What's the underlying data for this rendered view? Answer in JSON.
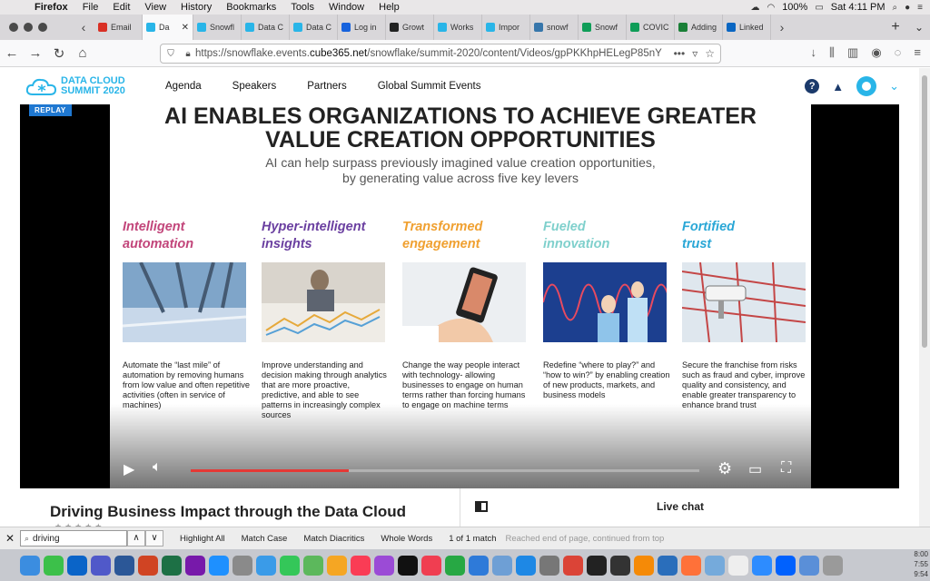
{
  "menubar": {
    "app": "Firefox",
    "items": [
      "File",
      "Edit",
      "View",
      "History",
      "Bookmarks",
      "Tools",
      "Window",
      "Help"
    ],
    "battery": "100%",
    "clock": "Sat 4:11 PM"
  },
  "tabs": [
    {
      "label": "Email",
      "icon": "gmail-icon",
      "color": "#d93025"
    },
    {
      "label": "Da",
      "icon": "snowflake-icon",
      "color": "#29b5e8",
      "active": true
    },
    {
      "label": "Snowfl",
      "icon": "snowflake-icon",
      "color": "#29b5e8"
    },
    {
      "label": "Data C",
      "icon": "snowflake-icon",
      "color": "#29b5e8"
    },
    {
      "label": "Data C",
      "icon": "snowflake-icon",
      "color": "#29b5e8"
    },
    {
      "label": "Log in",
      "icon": "okta-icon",
      "color": "#1662dd"
    },
    {
      "label": "Growt",
      "icon": "chart-icon",
      "color": "#222"
    },
    {
      "label": "Works",
      "icon": "snowflake-icon",
      "color": "#29b5e8"
    },
    {
      "label": "Impor",
      "icon": "snowflake-icon",
      "color": "#29b5e8"
    },
    {
      "label": "snowf",
      "icon": "python-icon",
      "color": "#3776ab"
    },
    {
      "label": "Snowf",
      "icon": "sheets-icon",
      "color": "#0f9d58"
    },
    {
      "label": "COVIC",
      "icon": "sheets-icon",
      "color": "#0f9d58"
    },
    {
      "label": "Adding",
      "icon": "gear-icon",
      "color": "#1a7f37"
    },
    {
      "label": "Linked",
      "icon": "linkedin-icon",
      "color": "#0a66c2"
    }
  ],
  "url": {
    "prefix": "https://snowflake.events.",
    "domain": "cube365.net",
    "path": "/snowflake/summit-2020/content/Videos/gpPKKhpHELegP85nY"
  },
  "site": {
    "logo_line1": "DATA CLOUD",
    "logo_line2": "SUMMIT 2020",
    "nav": [
      "Agenda",
      "Speakers",
      "Partners",
      "Global Summit Events"
    ]
  },
  "video": {
    "badge": "REPLAY",
    "title_line1": "AI ENABLES ORGANIZATIONS TO ACHIEVE GREATER",
    "title_line2": "VALUE CREATION OPPORTUNITIES",
    "subtitle_line1": "AI can help surpass previously imagined value creation opportunities,",
    "subtitle_line2": "by generating value across five key levers",
    "progress": 0.31,
    "levers": [
      {
        "line1": "Intelligent",
        "line2": "automation",
        "color": "#c2457a",
        "text": "Automate the “last mile” of automation by removing humans from low value and often repetitive activities (often in service of machines)"
      },
      {
        "line1": "Hyper-intelligent",
        "line2": "insights",
        "color": "#6a3fa0",
        "text": "Improve understanding and decision making through analytics that are more proactive, predictive, and able to see patterns in increasingly complex sources"
      },
      {
        "line1": "Transformed",
        "line2": "engagement",
        "color": "#f0a030",
        "text": "Change the way people interact with technology- allowing businesses to engage on human terms rather than forcing humans to engage on machine terms"
      },
      {
        "line1": "Fueled",
        "line2": "innovation",
        "color": "#7fd0cc",
        "text": "Redefine “where to play?” and “how to win?” by enabling creation of new products, markets, and business models"
      },
      {
        "line1": "Fortified",
        "line2": "trust",
        "color": "#2aa7d6",
        "text": "Secure the franchise from risks such as fraud and cyber, improve quality and consistency, and enable greater transparency to enhance brand trust"
      }
    ]
  },
  "page": {
    "title": "Driving Business Impact through the Data Cloud",
    "chat_label": "Live chat"
  },
  "findbar": {
    "query": "driving",
    "highlight_all": "Highlight All",
    "match_case": "Match Case",
    "match_diacritics": "Match Diacritics",
    "whole_words": "Whole Words",
    "status": "1 of 1 match",
    "note": "Reached end of page, continued from top"
  },
  "dock": {
    "icons": [
      {
        "name": "finder-icon",
        "color": "#3b8de0"
      },
      {
        "name": "facetime-icon",
        "color": "#3cc04a"
      },
      {
        "name": "outlook-icon",
        "color": "#0a64c8"
      },
      {
        "name": "teams-icon",
        "color": "#5059c9"
      },
      {
        "name": "word-icon",
        "color": "#2b5797"
      },
      {
        "name": "powerpoint-icon",
        "color": "#d04423"
      },
      {
        "name": "excel-icon",
        "color": "#1d7045"
      },
      {
        "name": "onenote-icon",
        "color": "#7719aa"
      },
      {
        "name": "safari-icon",
        "color": "#1e90ff"
      },
      {
        "name": "launchpad-icon",
        "color": "#8a8a8a"
      },
      {
        "name": "mail-icon",
        "color": "#3a9be8"
      },
      {
        "name": "messages-icon",
        "color": "#34c759"
      },
      {
        "name": "maps-icon",
        "color": "#5cb85c"
      },
      {
        "name": "photos-icon",
        "color": "#f5a623"
      },
      {
        "name": "music-icon",
        "color": "#fa3c55"
      },
      {
        "name": "podcasts-icon",
        "color": "#9b4bd6"
      },
      {
        "name": "tv-icon",
        "color": "#111111"
      },
      {
        "name": "news-icon",
        "color": "#f03e51"
      },
      {
        "name": "numbers-icon",
        "color": "#27a844"
      },
      {
        "name": "keynote-icon",
        "color": "#2e7ad9"
      },
      {
        "name": "preview-icon",
        "color": "#6e9fd5"
      },
      {
        "name": "appstore-icon",
        "color": "#1e88e5"
      },
      {
        "name": "settings-icon",
        "color": "#777777"
      },
      {
        "name": "chrome-icon",
        "color": "#db4437"
      },
      {
        "name": "terminal-icon",
        "color": "#222222"
      },
      {
        "name": "activity-monitor-icon",
        "color": "#333333"
      },
      {
        "name": "sublime-icon",
        "color": "#f58a07"
      },
      {
        "name": "sourcetree-icon",
        "color": "#2a6ebb"
      },
      {
        "name": "firefox-icon",
        "color": "#ff7139"
      },
      {
        "name": "rstudio-icon",
        "color": "#75aadb"
      },
      {
        "name": "textedit-icon",
        "color": "#eeeeee"
      },
      {
        "name": "zoom-icon",
        "color": "#2d8cff"
      },
      {
        "name": "dropbox-icon",
        "color": "#0061fe"
      },
      {
        "name": "downloads-icon",
        "color": "#5a8fd8"
      },
      {
        "name": "trash-icon",
        "color": "#9a9a9a"
      }
    ],
    "time1": "8:00",
    "time2": "7:55",
    "time3": "9:54"
  }
}
